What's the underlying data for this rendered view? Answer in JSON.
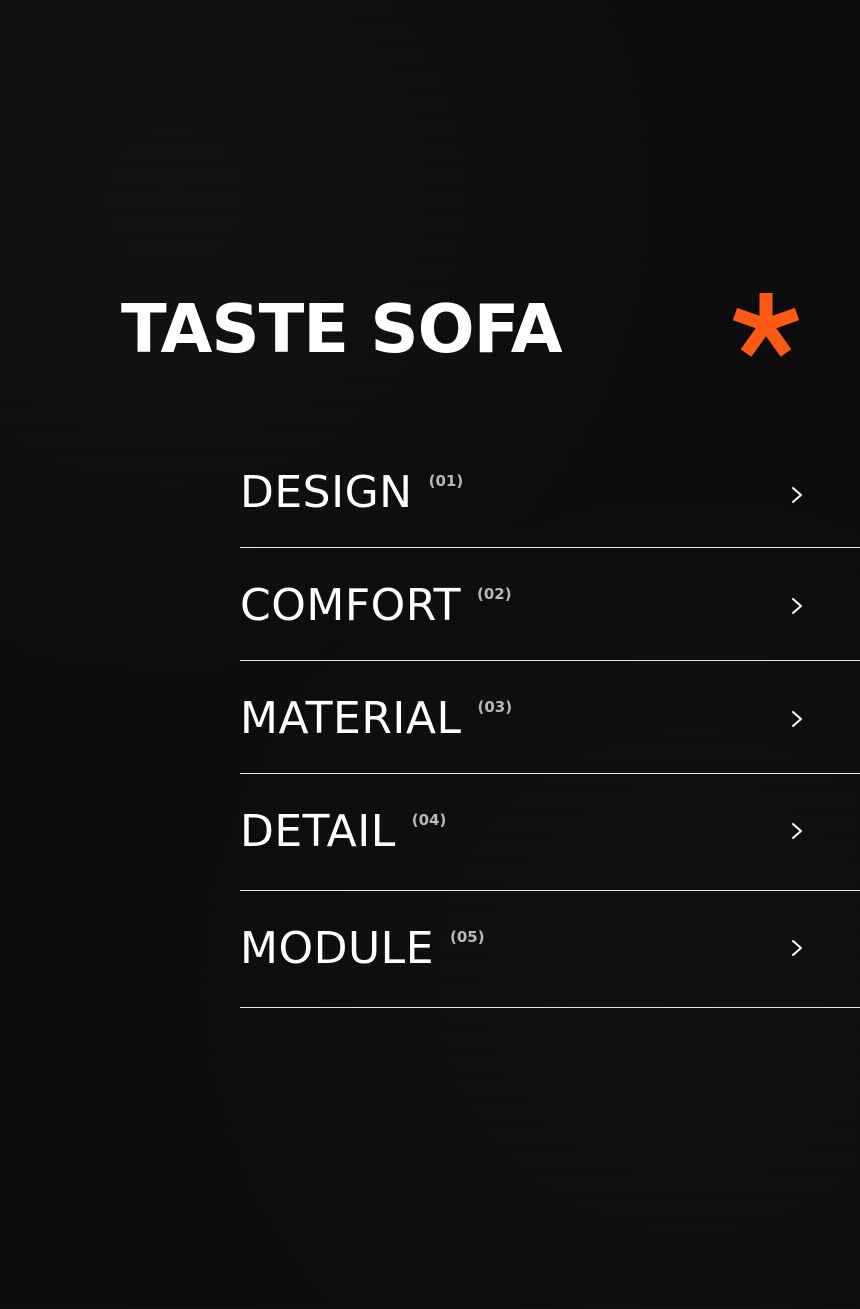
{
  "brand": {
    "title": "TASTE SOFA",
    "accent_color": "#ff5a14",
    "mark_icon": "asterisk-icon"
  },
  "menu": {
    "items": [
      {
        "label": "DESIGN",
        "number": "(01)",
        "icon": "chevron-right-icon"
      },
      {
        "label": "COMFORT",
        "number": "(02)",
        "icon": "chevron-right-icon"
      },
      {
        "label": "MATERIAL",
        "number": "(03)",
        "icon": "chevron-right-icon"
      },
      {
        "label": "DETAIL",
        "number": "(04)",
        "icon": "chevron-right-icon"
      },
      {
        "label": "MODULE",
        "number": "(05)",
        "icon": "chevron-right-icon"
      }
    ]
  },
  "colors": {
    "background": "#0b0b0b",
    "text": "#ffffff",
    "muted": "#b8b8b8",
    "divider": "#e6e6e6"
  }
}
